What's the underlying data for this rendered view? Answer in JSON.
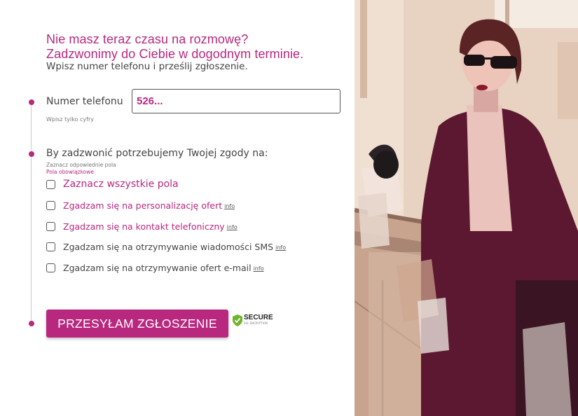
{
  "heading": {
    "line1": "Nie masz teraz czasu na rozmowę?",
    "line2": "Zadzwonimy do Ciebie w dogodnym terminie.",
    "subtitle": "Wpisz numer telefonu i prześlij zgłoszenie."
  },
  "phone": {
    "label": "Numer telefonu",
    "value": "526...",
    "hint": "Wpisz tylko cyfry"
  },
  "consents": {
    "title": "By zadzwonić potrzebujemy Twojej zgody na:",
    "hint": "Zaznacz odpowiednie pola",
    "required_note": "Pola obowiązkowe",
    "select_all": "Zaznacz wszystkie pola",
    "items": [
      {
        "label": "Zgadzam się na personalizację ofert",
        "info": "info"
      },
      {
        "label": "Zgadzam się na kontakt telefoniczny",
        "info": "info"
      },
      {
        "label": "Zgadzam się na otrzymywanie wiadomości SMS",
        "info": "info"
      },
      {
        "label": "Zgadzam się na otrzymywanie ofert e-mail",
        "info": "info"
      }
    ]
  },
  "submit_label": "PRZESYŁAM ZGŁOSZENIE",
  "secure_badge": {
    "text": "SECURE",
    "subtext": "SSL ENCRYPTION"
  },
  "colors": {
    "accent": "#b8287f",
    "text": "#444444",
    "secure_green": "#6fb52c"
  }
}
